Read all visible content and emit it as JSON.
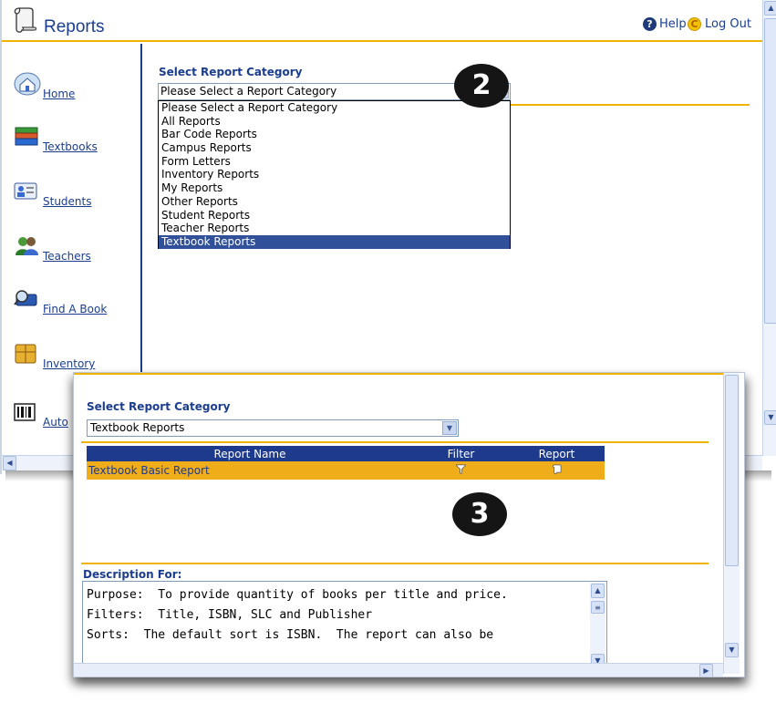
{
  "back_window": {
    "title": "Reports",
    "help_label": "Help",
    "logout_label": "Log Out",
    "sidebar": [
      {
        "label": "Home",
        "icon": "home-icon"
      },
      {
        "label": "Textbooks",
        "icon": "books-icon"
      },
      {
        "label": "Students",
        "icon": "student-card-icon"
      },
      {
        "label": "Teachers",
        "icon": "teachers-icon"
      },
      {
        "label": "Find A Book",
        "icon": "find-book-icon"
      },
      {
        "label": "Inventory",
        "icon": "inventory-box-icon"
      },
      {
        "label": "Auto",
        "icon": "barcode-icon"
      }
    ],
    "select_label": "Select Report Category",
    "select_value": "Please Select a Report Category",
    "dropdown_options": [
      "Please Select a Report Category",
      "All Reports",
      "Bar Code Reports",
      "Campus Reports",
      "Form Letters",
      "Inventory Reports",
      "My Reports",
      "Other Reports",
      "Student Reports",
      "Teacher Reports",
      "Textbook Reports"
    ],
    "highlighted_option": "Textbook Reports"
  },
  "badges": {
    "step2": "2",
    "step3": "3"
  },
  "front_window": {
    "select_label": "Select Report Category",
    "select_value": "Textbook Reports",
    "table": {
      "headers": [
        "Report Name",
        "Filter",
        "Report"
      ],
      "rows": [
        {
          "name": "Textbook Basic Report"
        }
      ]
    },
    "description_label": "Description For:",
    "description_lines": [
      "Purpose:  To provide quantity of books per title and price.",
      "Filters:  Title, ISBN, SLC and Publisher",
      "Sorts:  The default sort is ISBN.  The report can also be"
    ]
  },
  "colors": {
    "brand_blue": "#1b3d8f",
    "accent_gold": "#f0b400",
    "row_highlight": "#f0ad1a",
    "selection_blue": "#30509a"
  }
}
